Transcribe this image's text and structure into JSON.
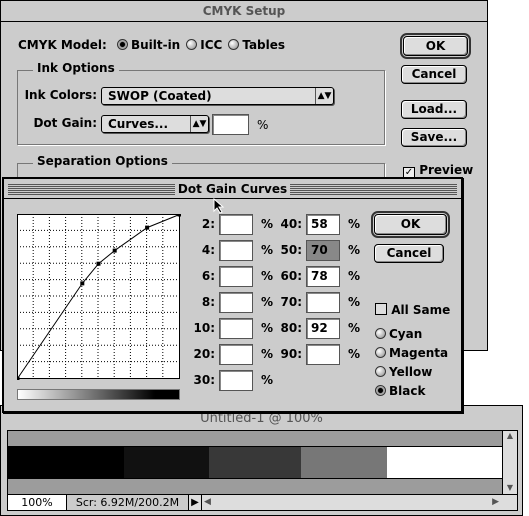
{
  "cmyk_setup": {
    "title": "CMYK Setup",
    "model_label": "CMYK Model:",
    "models": [
      {
        "label": "Built-in",
        "selected": true
      },
      {
        "label": "ICC",
        "selected": false
      },
      {
        "label": "Tables",
        "selected": false
      }
    ],
    "ink_options": {
      "title": "Ink Options",
      "ink_colors_label": "Ink Colors:",
      "ink_colors_value": "SWOP (Coated)",
      "dot_gain_label": "Dot Gain:",
      "dot_gain_value": "Curves...",
      "dot_gain_percent": "",
      "percent": "%"
    },
    "separation_options": {
      "title": "Separation Options"
    },
    "buttons": {
      "ok": "OK",
      "cancel": "Cancel",
      "load": "Load...",
      "save": "Save..."
    },
    "preview": {
      "label": "Preview",
      "checked": true
    }
  },
  "dot_gain_curves": {
    "title": "Dot Gain Curves",
    "percent": "%",
    "left_fields": [
      {
        "label": "2:",
        "value": ""
      },
      {
        "label": "4:",
        "value": ""
      },
      {
        "label": "6:",
        "value": ""
      },
      {
        "label": "8:",
        "value": ""
      },
      {
        "label": "10:",
        "value": ""
      },
      {
        "label": "20:",
        "value": ""
      },
      {
        "label": "30:",
        "value": ""
      }
    ],
    "right_fields": [
      {
        "label": "40:",
        "value": "58"
      },
      {
        "label": "50:",
        "value": "70",
        "selected": true
      },
      {
        "label": "60:",
        "value": "78"
      },
      {
        "label": "70:",
        "value": ""
      },
      {
        "label": "80:",
        "value": "92"
      },
      {
        "label": "90:",
        "value": ""
      }
    ],
    "buttons": {
      "ok": "OK",
      "cancel": "Cancel"
    },
    "all_same": {
      "label": "All Same",
      "checked": false
    },
    "channels": [
      {
        "label": "Cyan",
        "selected": false
      },
      {
        "label": "Magenta",
        "selected": false
      },
      {
        "label": "Yellow",
        "selected": false
      },
      {
        "label": "Black",
        "selected": true
      }
    ]
  },
  "chart_data": {
    "type": "line",
    "x": [
      0,
      40,
      50,
      60,
      80,
      100
    ],
    "y": [
      0,
      58,
      70,
      78,
      92,
      100
    ],
    "xlim": [
      0,
      100
    ],
    "ylim": [
      0,
      100
    ],
    "grid": true
  },
  "document": {
    "title": "Untitled-1 @ 100%",
    "swatches": [
      "#000000",
      "#111111",
      "#383838",
      "#777777",
      "#ffffff"
    ],
    "zoom": "100%",
    "scratch": "Scr: 6.92M/200.2M"
  }
}
